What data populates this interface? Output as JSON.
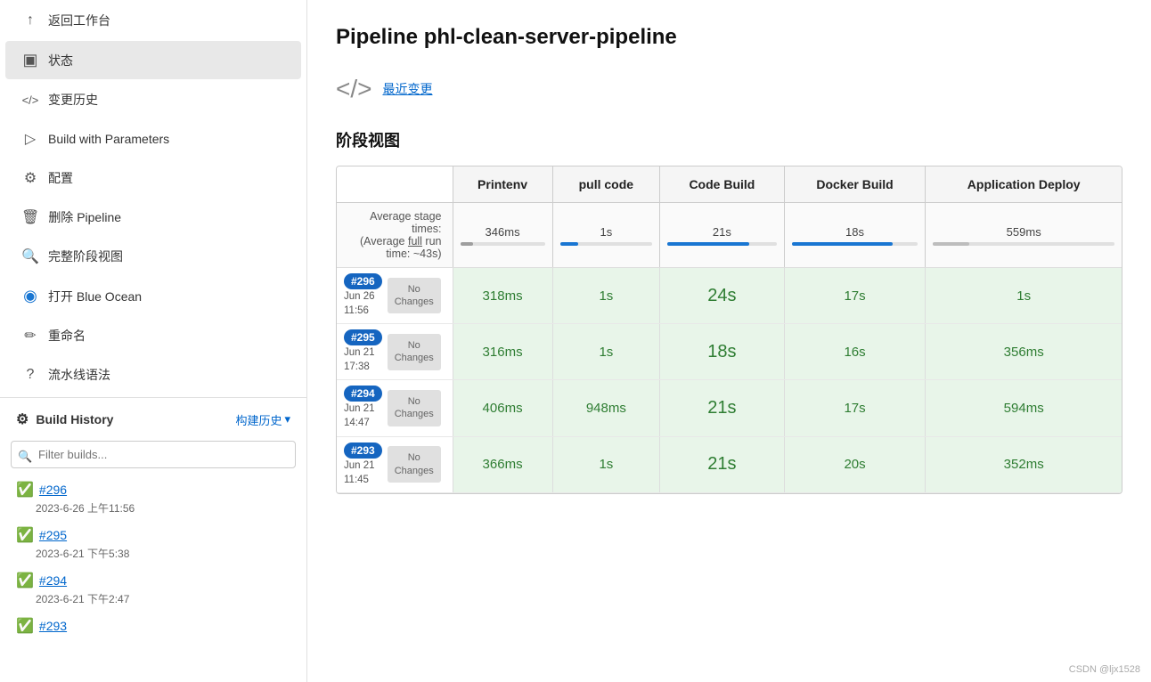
{
  "sidebar": {
    "items": [
      {
        "id": "back",
        "label": "返回工作台",
        "icon": "↑",
        "active": false
      },
      {
        "id": "status",
        "label": "状态",
        "icon": "▣",
        "active": true
      },
      {
        "id": "history",
        "label": "变更历史",
        "icon": "</>",
        "active": false
      },
      {
        "id": "build-params",
        "label": "Build with Parameters",
        "icon": "▷",
        "active": false
      },
      {
        "id": "config",
        "label": "配置",
        "icon": "⚙",
        "active": false
      },
      {
        "id": "delete",
        "label": "删除 Pipeline",
        "icon": "🗑",
        "active": false
      },
      {
        "id": "full-stage",
        "label": "完整阶段视图",
        "icon": "🔍",
        "active": false
      },
      {
        "id": "blue-ocean",
        "label": "打开 Blue Ocean",
        "icon": "●",
        "active": false
      },
      {
        "id": "rename",
        "label": "重命名",
        "icon": "✏",
        "active": false
      },
      {
        "id": "syntax",
        "label": "流水线语法",
        "icon": "?",
        "active": false
      }
    ],
    "build_history": {
      "title": "Build History",
      "link_label": "构建历史",
      "filter_placeholder": "Filter builds...",
      "builds": [
        {
          "num": "#296",
          "date": "2023-6-26 上午11:56",
          "success": true
        },
        {
          "num": "#295",
          "date": "2023-6-21 下午5:38",
          "success": true
        },
        {
          "num": "#294",
          "date": "2023-6-21 下午2:47",
          "success": true
        },
        {
          "num": "#293",
          "date": "",
          "success": true
        }
      ]
    }
  },
  "main": {
    "title": "Pipeline phl-clean-server-pipeline",
    "recent_change_label": "最近变更",
    "stage_view_title": "阶段视图",
    "avg_label_line1": "Average stage times:",
    "avg_label_line2": "(Average full run time: ~43s)",
    "columns": [
      {
        "id": "printenv",
        "label": "Printenv"
      },
      {
        "id": "pull-code",
        "label": "pull code"
      },
      {
        "id": "code-build",
        "label": "Code Build"
      },
      {
        "id": "docker-build",
        "label": "Docker Build"
      },
      {
        "id": "app-deploy",
        "label": "Application Deploy"
      }
    ],
    "averages": [
      {
        "value": "346ms",
        "progress": 15,
        "color": "#9e9e9e"
      },
      {
        "value": "1s",
        "progress": 20,
        "color": "#1976d2"
      },
      {
        "value": "21s",
        "progress": 75,
        "color": "#1976d2"
      },
      {
        "value": "18s",
        "progress": 80,
        "color": "#1976d2"
      },
      {
        "value": "559ms",
        "progress": 20,
        "color": "#bdbdbd"
      }
    ],
    "builds": [
      {
        "badge": "#296",
        "date_line1": "Jun 26",
        "date_line2": "11:56",
        "no_changes": "No\nChanges",
        "stages": [
          "318ms",
          "1s",
          "24s",
          "17s",
          "1s"
        ],
        "large": [
          false,
          false,
          true,
          false,
          false
        ]
      },
      {
        "badge": "#295",
        "date_line1": "Jun 21",
        "date_line2": "17:38",
        "no_changes": "No\nChanges",
        "stages": [
          "316ms",
          "1s",
          "18s",
          "16s",
          "356ms"
        ],
        "large": [
          false,
          false,
          true,
          false,
          false
        ]
      },
      {
        "badge": "#294",
        "date_line1": "Jun 21",
        "date_line2": "14:47",
        "no_changes": "No\nChanges",
        "stages": [
          "406ms",
          "948ms",
          "21s",
          "17s",
          "594ms"
        ],
        "large": [
          false,
          false,
          true,
          false,
          false
        ]
      },
      {
        "badge": "#293",
        "date_line1": "Jun 21",
        "date_line2": "11:45",
        "no_changes": "No\nChanges",
        "stages": [
          "366ms",
          "1s",
          "21s",
          "20s",
          "352ms"
        ],
        "large": [
          false,
          false,
          true,
          false,
          false
        ]
      }
    ]
  },
  "watermark": "CSDN @ljx1528"
}
